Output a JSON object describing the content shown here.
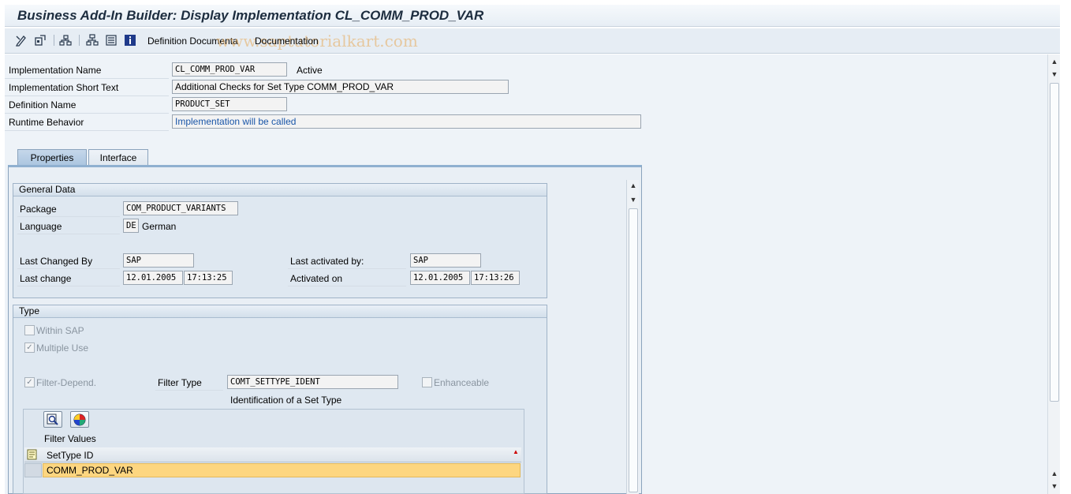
{
  "window": {
    "title": "Business Add-In Builder: Display Implementation CL_COMM_PROD_VAR"
  },
  "toolbar": {
    "icons": [
      "change-icon",
      "activate-icon",
      "hierarchy-icon",
      "tree-icon",
      "list-icon",
      "info-icon"
    ],
    "definition_documentation": "Definition Documenta",
    "documentation": "Documentation",
    "watermark": "www.saptutorialkart.com"
  },
  "header": {
    "impl_name_label": "Implementation Name",
    "impl_name_value": "CL_COMM_PROD_VAR",
    "impl_status": "Active",
    "short_text_label": "Implementation Short Text",
    "short_text_value": "Additional Checks for Set Type COMM_PROD_VAR",
    "definition_name_label": "Definition Name",
    "definition_name_value": "PRODUCT_SET",
    "runtime_label": "Runtime Behavior",
    "runtime_value": "Implementation will be called"
  },
  "tabs": [
    {
      "label": "Properties",
      "active": true
    },
    {
      "label": "Interface",
      "active": false
    }
  ],
  "general": {
    "title": "General Data",
    "package_label": "Package",
    "package_value": "COM_PRODUCT_VARIANTS",
    "language_label": "Language",
    "language_code": "DE",
    "language_name": "German",
    "last_changed_by_label": "Last Changed By",
    "last_changed_by_value": "SAP",
    "last_change_label": "Last change",
    "last_change_date": "12.01.2005",
    "last_change_time": "17:13:25",
    "last_activated_by_label": "Last activated by:",
    "last_activated_by_value": "SAP",
    "activated_on_label": "Activated on",
    "activated_on_date": "12.01.2005",
    "activated_on_time": "17:13:26"
  },
  "type": {
    "title": "Type",
    "within_sap": {
      "label": "Within SAP",
      "checked": false
    },
    "multiple_use": {
      "label": "Multiple Use",
      "checked": true
    },
    "filter_depend": {
      "label": "Filter-Depend.",
      "checked": true
    },
    "filter_type_label": "Filter Type",
    "filter_type_value": "COMT_SETTYPE_IDENT",
    "filter_type_desc": "Identification of a Set Type",
    "enhanceable": {
      "label": "Enhanceable",
      "checked": false
    }
  },
  "filter_values": {
    "title": "Filter Values",
    "column": "SetType ID",
    "rows": [
      "COMM_PROD_VAR"
    ]
  },
  "colors": {
    "selected_row": "#fdd680",
    "tab_active": "#a9c4df",
    "runtime_text": "#1a56a8"
  }
}
